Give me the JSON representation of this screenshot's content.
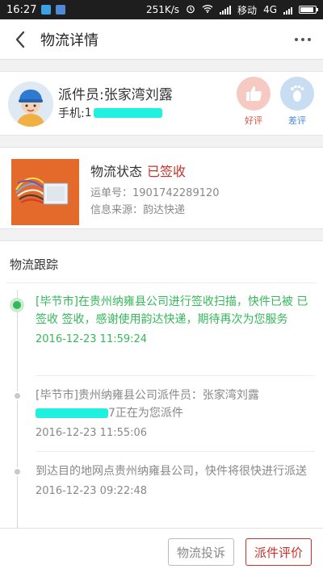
{
  "status_bar": {
    "time": "16:27",
    "speed": "251K/s",
    "carrier": "移动",
    "network": "4G"
  },
  "header": {
    "title": "物流详情"
  },
  "courier": {
    "name": "派件员:张家湾刘露",
    "phone_label": "手机:",
    "phone_partial": "1",
    "good_label": "好评",
    "bad_label": "差评"
  },
  "package": {
    "status_label": "物流状态",
    "status_value": "已签收",
    "tracking": "运单号：1901742289120",
    "source": "信息来源：韵达快递"
  },
  "tracking": {
    "title": "物流跟踪",
    "events": [
      {
        "text": "[毕节市]在贵州纳雍县公司进行签收扫描，快件已被 已签收 签收，感谢使用韵达快递，期待再次为您服务",
        "time": "2016-12-23 11:59:24"
      },
      {
        "text_a": "[毕节市]贵州纳雍县公司派件员：张家湾刘露",
        "text_b_tail": "7正在为您派件",
        "time": "2016-12-23 11:55:06"
      },
      {
        "text": "到达目的地网点贵州纳雍县公司，快件将很快进行派送",
        "time": "2016-12-23 09:22:48"
      }
    ]
  },
  "footer": {
    "complain_label": "物流投诉",
    "rate_label": "派件评价"
  },
  "colors": {
    "accent_red": "#c7312a",
    "active_green": "#35b85a",
    "good_red": "#d9533f",
    "bad_blue": "#4a8ad8"
  }
}
